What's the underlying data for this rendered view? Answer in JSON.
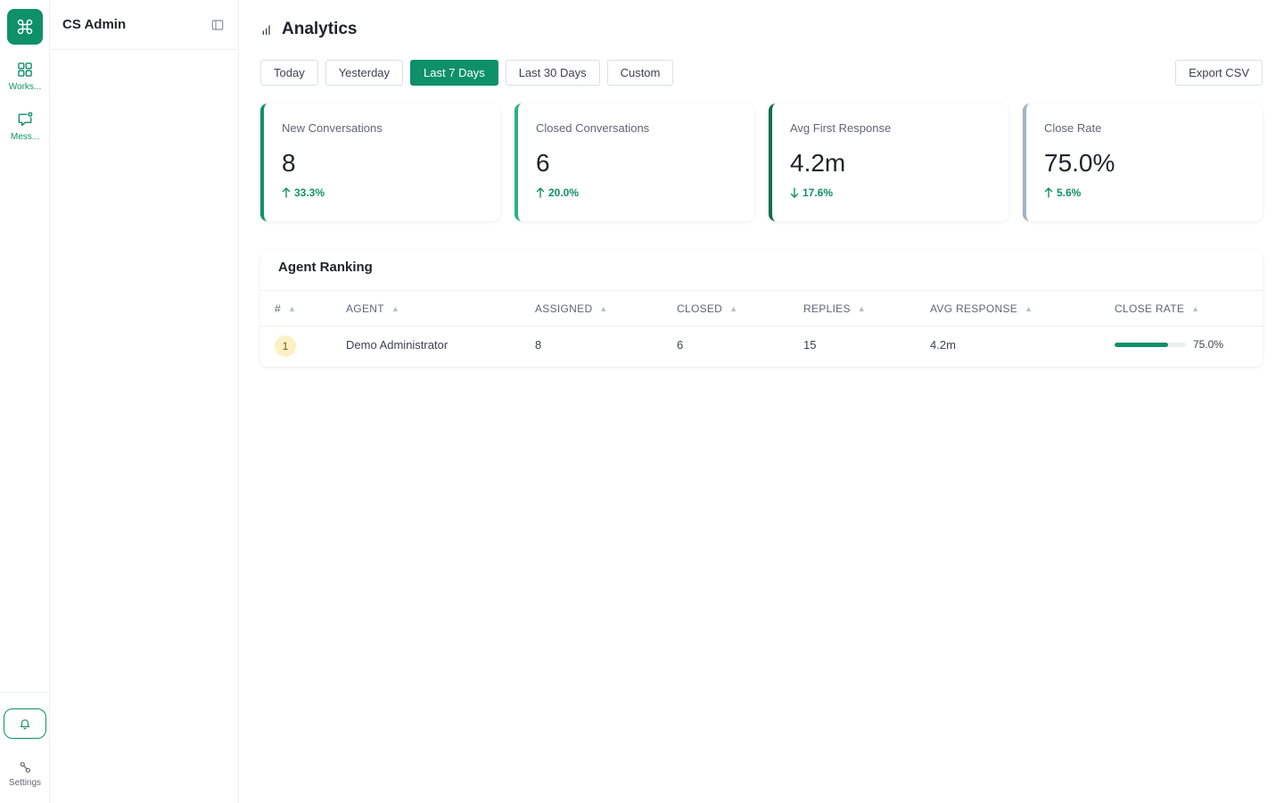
{
  "app": {
    "panel_title": "CS Admin",
    "accent_color": "#0e9168"
  },
  "rail": {
    "items": [
      {
        "label": "Works...",
        "icon": "grid-icon"
      },
      {
        "label": "Mess...",
        "icon": "message-icon"
      }
    ],
    "bell_icon": "bell-icon",
    "settings_label": "Settings"
  },
  "page": {
    "title": "Analytics",
    "icon": "bar-chart-icon"
  },
  "ranges": [
    {
      "label": "Today",
      "active": false
    },
    {
      "label": "Yesterday",
      "active": false
    },
    {
      "label": "Last 7 Days",
      "active": true
    },
    {
      "label": "Last 30 Days",
      "active": false
    },
    {
      "label": "Custom",
      "active": false
    }
  ],
  "export_label": "Export CSV",
  "cards": [
    {
      "label": "New Conversations",
      "value": "8",
      "delta": "33.3%",
      "direction": "up"
    },
    {
      "label": "Closed Conversations",
      "value": "6",
      "delta": "20.0%",
      "direction": "up"
    },
    {
      "label": "Avg First Response",
      "value": "4.2m",
      "delta": "17.6%",
      "direction": "down"
    },
    {
      "label": "Close Rate",
      "value": "75.0%",
      "delta": "5.6%",
      "direction": "up"
    }
  ],
  "ranking": {
    "title": "Agent Ranking",
    "columns": [
      "#",
      "AGENT",
      "ASSIGNED",
      "CLOSED",
      "REPLIES",
      "AVG RESPONSE",
      "CLOSE RATE"
    ],
    "rows": [
      {
        "rank": "1",
        "agent": "Demo Administrator",
        "assigned": "8",
        "closed": "6",
        "replies": "15",
        "avg_response": "4.2m",
        "close_rate": "75.0%",
        "close_rate_fraction": 0.75
      }
    ]
  }
}
